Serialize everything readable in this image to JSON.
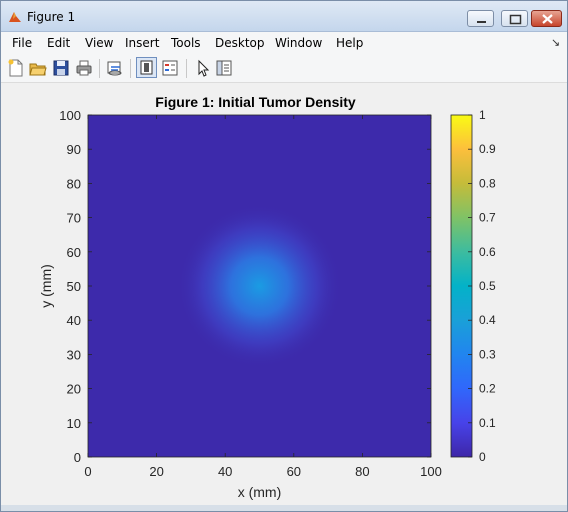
{
  "window": {
    "title": "Figure 1",
    "icon": "matlab-icon"
  },
  "menubar": {
    "items": [
      "File",
      "Edit",
      "View",
      "Insert",
      "Tools",
      "Desktop",
      "Window",
      "Help"
    ]
  },
  "toolbar": {
    "buttons": [
      "new-figure-icon",
      "open-file-icon",
      "save-icon",
      "print-icon",
      "link-plot-icon",
      "colorbar-toggle-icon",
      "legend-toggle-icon",
      "select-pointer-icon",
      "property-inspector-icon"
    ]
  },
  "chart_data": {
    "type": "heatmap",
    "title": "Figure 1: Initial Tumor Density",
    "xlabel": "x (mm)",
    "ylabel": "y (mm)",
    "xlim": [
      0,
      100
    ],
    "ylim": [
      0,
      100
    ],
    "x_ticks": [
      0,
      20,
      40,
      60,
      80,
      100
    ],
    "y_ticks": [
      0,
      10,
      20,
      30,
      40,
      50,
      60,
      70,
      80,
      90,
      100
    ],
    "colorbar": {
      "colormap": "parula",
      "limits": [
        0,
        1
      ],
      "ticks": [
        0,
        0.1,
        0.2,
        0.3,
        0.4,
        0.5,
        0.6,
        0.7,
        0.8,
        0.9,
        1
      ]
    },
    "field": {
      "background_value": 0.02,
      "blob_center": [
        50,
        50
      ],
      "blob_peak": 0.42,
      "blob_sigma": 4
    },
    "colors": {
      "background": "#3d2aab",
      "peak": "#1a9ce3"
    }
  }
}
